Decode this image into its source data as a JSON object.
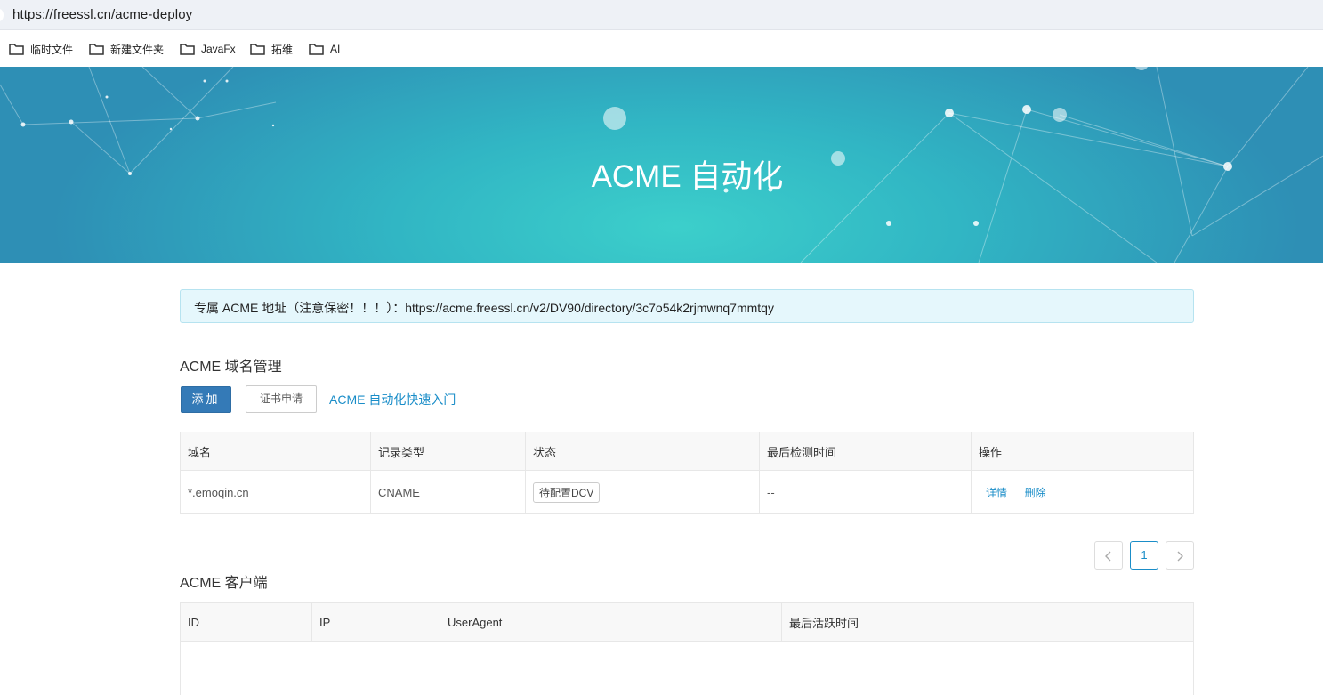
{
  "browser": {
    "url": "https://freessl.cn/acme-deploy",
    "bookmarks": [
      {
        "label": "临时文件"
      },
      {
        "label": "新建文件夹"
      },
      {
        "label": "JavaFx"
      },
      {
        "label": "拓维"
      },
      {
        "label": "AI"
      }
    ]
  },
  "hero": {
    "title": "ACME 自动化"
  },
  "alert": {
    "text": "专属 ACME 地址（注意保密！！！）：https://acme.freessl.cn/v2/DV90/directory/3c7o54k2rjmwnq7mmtqy"
  },
  "domains": {
    "title": "ACME 域名管理",
    "add_label": "添加",
    "apply_label": "证书申请",
    "guide_link": "ACME 自动化快速入门",
    "columns": [
      "域名",
      "记录类型",
      "状态",
      "最后检测时间",
      "操作"
    ],
    "rows": [
      {
        "domain": "*.emoqin.cn",
        "record_type": "CNAME",
        "status": "待配置DCV",
        "last_check": "--",
        "action_detail": "详情",
        "action_delete": "删除"
      }
    ],
    "pagination": {
      "prev": "‹",
      "current": "1",
      "next": "›"
    }
  },
  "clients": {
    "title": "ACME 客户端",
    "columns": [
      "ID",
      "IP",
      "UserAgent",
      "最后活跃时间"
    ]
  },
  "colors": {
    "primary": "#347ab7",
    "link": "#1a8dc8",
    "hero_center": "#3ccfcb",
    "hero_edge": "#2e8fb5",
    "alert_bg": "#e5f7fc"
  },
  "icons": {
    "bookmark": "folder-icon",
    "prev": "chevron-left-icon",
    "next": "chevron-right-icon"
  }
}
